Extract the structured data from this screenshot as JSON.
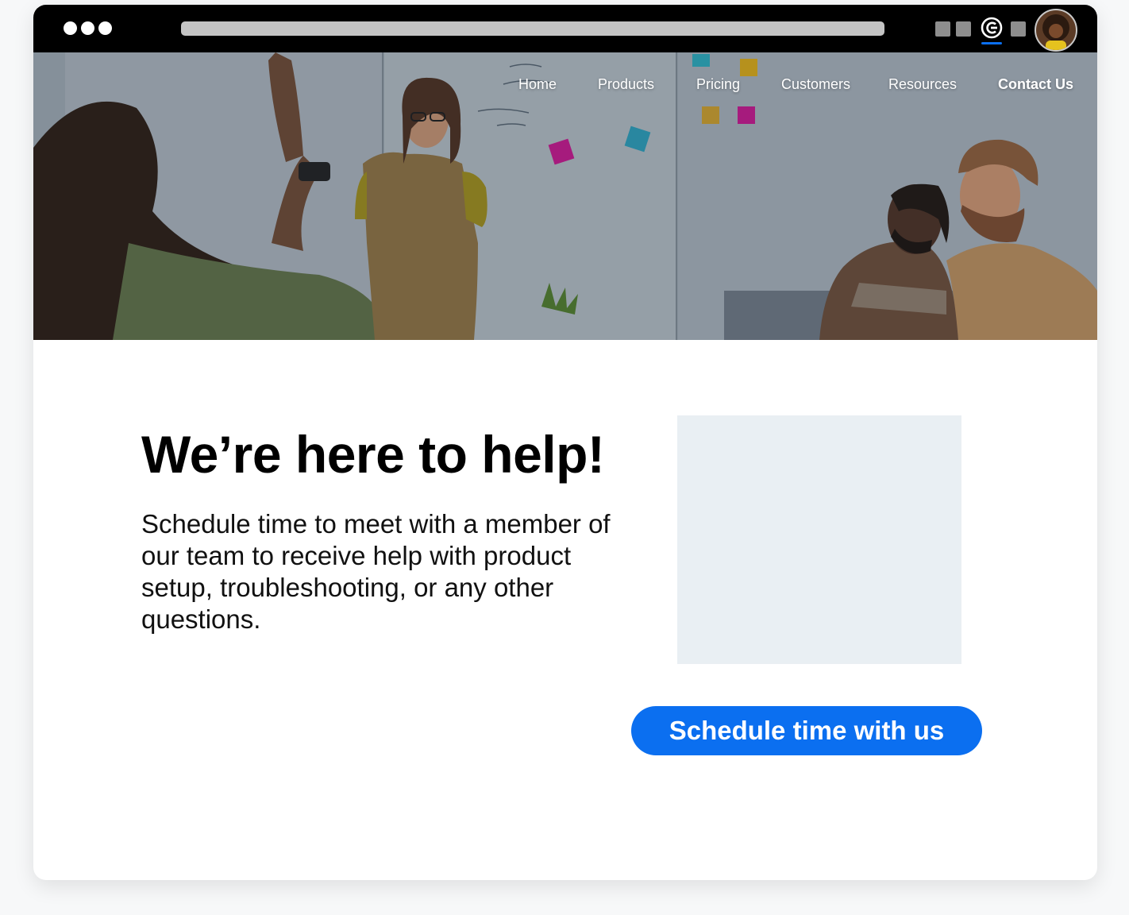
{
  "nav": {
    "items": [
      {
        "label": "Home"
      },
      {
        "label": "Products"
      },
      {
        "label": "Pricing"
      },
      {
        "label": "Customers"
      },
      {
        "label": "Resources"
      },
      {
        "label": "Contact Us"
      }
    ],
    "active": "Contact Us"
  },
  "main": {
    "headline": "We’re here to help!",
    "lead": "Schedule time to meet with a member of our team to receive help with product setup, troubleshooting, or any other questions.",
    "cta_label": "Schedule time with us"
  },
  "icons": {
    "window_controls": "three-dots-icon",
    "brand": "brand-c-logo-icon",
    "extensions": [
      "extension-icon",
      "extension-icon",
      "extension-icon"
    ],
    "profile": "user-avatar"
  },
  "colors": {
    "accent": "#0b6ff0",
    "chrome": "#000000",
    "placeholder": "#e9eff3"
  }
}
